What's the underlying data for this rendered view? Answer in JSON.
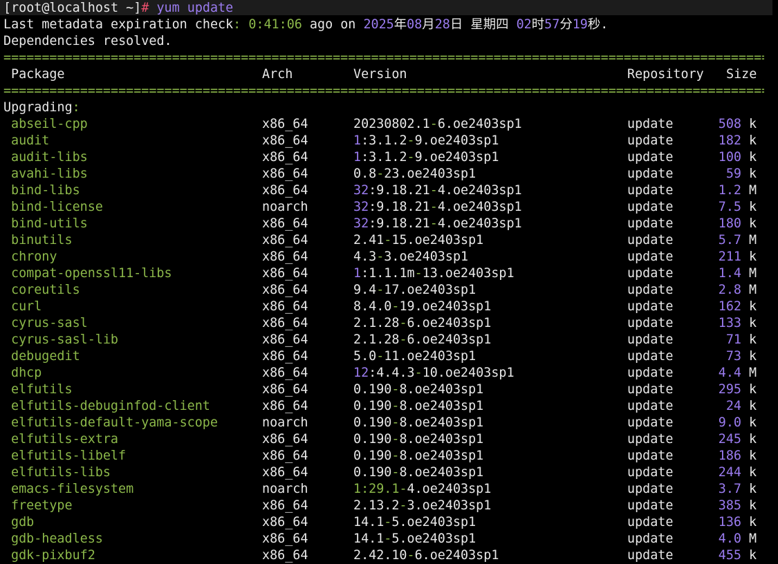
{
  "prompt": {
    "user": "[root@localhost ~]",
    "symbol": "#",
    "command": "yum update"
  },
  "meta_line": {
    "prefix": "Last metadata expiration check",
    "colon": ":",
    "elapsed": "0:41:06",
    "ago_on": "ago on",
    "year": "2025",
    "y_char": "年",
    "month": "08",
    "m_char": "月",
    "day": "28",
    "d_char": "日",
    "weekday": "星期四",
    "hour": "02",
    "h_char": "时",
    "minute": "57",
    "min_char": "分",
    "second": "19",
    "s_char": "秒",
    "end": "."
  },
  "deps_line": "Dependencies resolved.",
  "separator": "===============================================================================================================================================",
  "columns": {
    "package": "Package",
    "arch": "Arch",
    "version": "Version",
    "repository": "Repository",
    "size": "Size"
  },
  "section_label": "Upgrading",
  "section_colon": ":",
  "packages": [
    {
      "name": "abseil-cpp",
      "arch": "x86_64",
      "epoch": "",
      "ver": "20230802.1",
      "rel": "6.oe2403sp1",
      "repo": "update",
      "size": "508",
      "unit": "k"
    },
    {
      "name": "audit",
      "arch": "x86_64",
      "epoch": "1",
      "ver": "3.1.2",
      "rel": "9.oe2403sp1",
      "repo": "update",
      "size": "182",
      "unit": "k"
    },
    {
      "name": "audit-libs",
      "arch": "x86_64",
      "epoch": "1",
      "ver": "3.1.2",
      "rel": "9.oe2403sp1",
      "repo": "update",
      "size": "100",
      "unit": "k"
    },
    {
      "name": "avahi-libs",
      "arch": "x86_64",
      "epoch": "",
      "ver": "0.8",
      "rel": "23.oe2403sp1",
      "repo": "update",
      "size": "59",
      "unit": "k"
    },
    {
      "name": "bind-libs",
      "arch": "x86_64",
      "epoch": "32",
      "ver": "9.18.21",
      "rel": "4.oe2403sp1",
      "repo": "update",
      "size": "1.2",
      "unit": "M"
    },
    {
      "name": "bind-license",
      "arch": "noarch",
      "epoch": "32",
      "ver": "9.18.21",
      "rel": "4.oe2403sp1",
      "repo": "update",
      "size": "7.5",
      "unit": "k"
    },
    {
      "name": "bind-utils",
      "arch": "x86_64",
      "epoch": "32",
      "ver": "9.18.21",
      "rel": "4.oe2403sp1",
      "repo": "update",
      "size": "180",
      "unit": "k"
    },
    {
      "name": "binutils",
      "arch": "x86_64",
      "epoch": "",
      "ver": "2.41",
      "rel": "15.oe2403sp1",
      "repo": "update",
      "size": "5.7",
      "unit": "M"
    },
    {
      "name": "chrony",
      "arch": "x86_64",
      "epoch": "",
      "ver": "4.3",
      "rel": "3.oe2403sp1",
      "repo": "update",
      "size": "211",
      "unit": "k"
    },
    {
      "name": "compat-openssl11-libs",
      "arch": "x86_64",
      "epoch": "1",
      "ver": "1.1.1m",
      "rel": "13.oe2403sp1",
      "repo": "update",
      "size": "1.4",
      "unit": "M"
    },
    {
      "name": "coreutils",
      "arch": "x86_64",
      "epoch": "",
      "ver": "9.4",
      "rel": "17.oe2403sp1",
      "repo": "update",
      "size": "2.8",
      "unit": "M"
    },
    {
      "name": "curl",
      "arch": "x86_64",
      "epoch": "",
      "ver": "8.4.0",
      "rel": "19.oe2403sp1",
      "repo": "update",
      "size": "162",
      "unit": "k"
    },
    {
      "name": "cyrus-sasl",
      "arch": "x86_64",
      "epoch": "",
      "ver": "2.1.28",
      "rel": "6.oe2403sp1",
      "repo": "update",
      "size": "133",
      "unit": "k"
    },
    {
      "name": "cyrus-sasl-lib",
      "arch": "x86_64",
      "epoch": "",
      "ver": "2.1.28",
      "rel": "6.oe2403sp1",
      "repo": "update",
      "size": "71",
      "unit": "k"
    },
    {
      "name": "debugedit",
      "arch": "x86_64",
      "epoch": "",
      "ver": "5.0",
      "rel": "11.oe2403sp1",
      "repo": "update",
      "size": "73",
      "unit": "k"
    },
    {
      "name": "dhcp",
      "arch": "x86_64",
      "epoch": "12",
      "ver": "4.4.3",
      "rel": "10.oe2403sp1",
      "repo": "update",
      "size": "4.4",
      "unit": "M"
    },
    {
      "name": "elfutils",
      "arch": "x86_64",
      "epoch": "",
      "ver": "0.190",
      "rel": "8.oe2403sp1",
      "repo": "update",
      "size": "295",
      "unit": "k"
    },
    {
      "name": "elfutils-debuginfod-client",
      "arch": "x86_64",
      "epoch": "",
      "ver": "0.190",
      "rel": "8.oe2403sp1",
      "repo": "update",
      "size": "24",
      "unit": "k"
    },
    {
      "name": "elfutils-default-yama-scope",
      "arch": "noarch",
      "epoch": "",
      "ver": "0.190",
      "rel": "8.oe2403sp1",
      "repo": "update",
      "size": "9.0",
      "unit": "k"
    },
    {
      "name": "elfutils-extra",
      "arch": "x86_64",
      "epoch": "",
      "ver": "0.190",
      "rel": "8.oe2403sp1",
      "repo": "update",
      "size": "245",
      "unit": "k"
    },
    {
      "name": "elfutils-libelf",
      "arch": "x86_64",
      "epoch": "",
      "ver": "0.190",
      "rel": "8.oe2403sp1",
      "repo": "update",
      "size": "186",
      "unit": "k"
    },
    {
      "name": "elfutils-libs",
      "arch": "x86_64",
      "epoch": "",
      "ver": "0.190",
      "rel": "8.oe2403sp1",
      "repo": "update",
      "size": "244",
      "unit": "k"
    },
    {
      "name": "emacs-filesystem",
      "arch": "noarch",
      "epoch": "1",
      "ver": "29.1",
      "rel": "4.oe2403sp1",
      "repo": "update",
      "size": "3.7",
      "unit": "k",
      "green_ver": true
    },
    {
      "name": "freetype",
      "arch": "x86_64",
      "epoch": "",
      "ver": "2.13.2",
      "rel": "3.oe2403sp1",
      "repo": "update",
      "size": "385",
      "unit": "k"
    },
    {
      "name": "gdb",
      "arch": "x86_64",
      "epoch": "",
      "ver": "14.1",
      "rel": "5.oe2403sp1",
      "repo": "update",
      "size": "136",
      "unit": "k"
    },
    {
      "name": "gdb-headless",
      "arch": "x86_64",
      "epoch": "",
      "ver": "14.1",
      "rel": "5.oe2403sp1",
      "repo": "update",
      "size": "4.0",
      "unit": "M"
    },
    {
      "name": "gdk-pixbuf2",
      "arch": "x86_64",
      "epoch": "",
      "ver": "2.42.10",
      "rel": "6.oe2403sp1",
      "repo": "update",
      "size": "455",
      "unit": "k"
    }
  ],
  "colors": {
    "background": "#000000",
    "text": "#e8e8e8",
    "green": "#8cb84a",
    "purple": "#9b7cf0",
    "prompt_symbol": "#f0506e"
  }
}
